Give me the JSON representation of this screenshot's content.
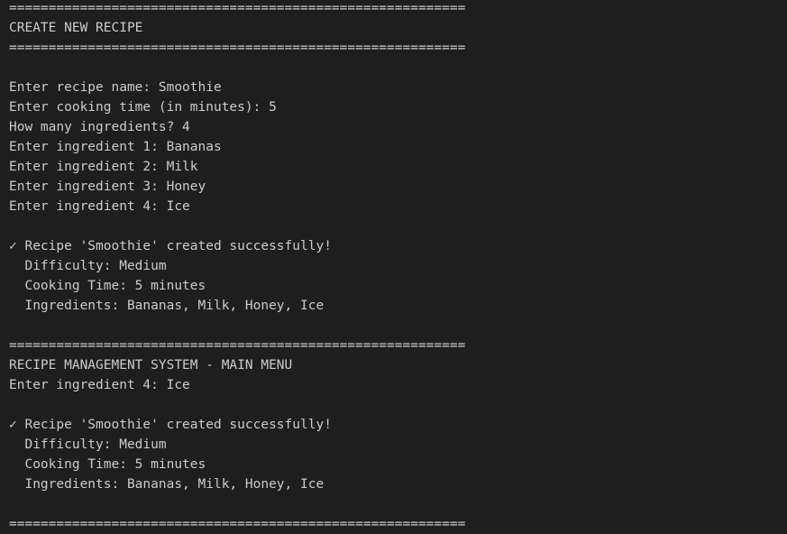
{
  "terminal": {
    "lines": [
      "==========================================================",
      "CREATE NEW RECIPE",
      "==========================================================",
      "",
      "Enter recipe name: Smoothie",
      "Enter cooking time (in minutes): 5",
      "How many ingredients? 4",
      "Enter ingredient 1: Bananas",
      "Enter ingredient 2: Milk",
      "Enter ingredient 3: Honey",
      "Enter ingredient 4: Ice",
      "",
      "✓ Recipe 'Smoothie' created successfully!",
      "  Difficulty: Medium",
      "  Cooking Time: 5 minutes",
      "  Ingredients: Bananas, Milk, Honey, Ice",
      "",
      "==========================================================",
      "RECIPE MANAGEMENT SYSTEM - MAIN MENU",
      "Enter ingredient 4: Ice",
      "",
      "✓ Recipe 'Smoothie' created successfully!",
      "  Difficulty: Medium",
      "  Cooking Time: 5 minutes",
      "  Ingredients: Bananas, Milk, Honey, Ice",
      "",
      "=========================================================="
    ]
  },
  "colors": {
    "background": "#1e1e1e",
    "text": "#cccccc"
  }
}
